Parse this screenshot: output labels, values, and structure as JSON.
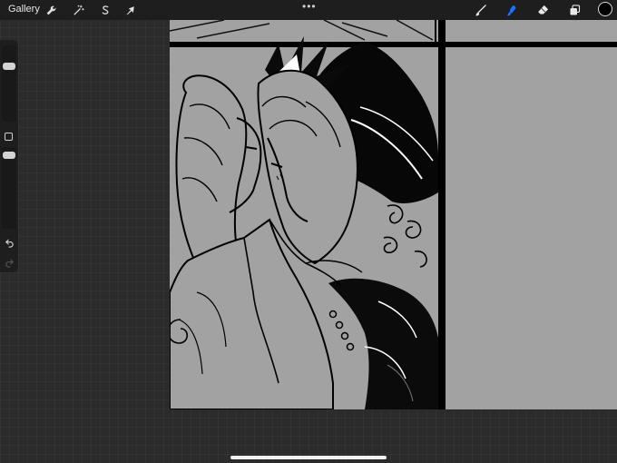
{
  "toolbar": {
    "gallery_label": "Gallery",
    "actions_icon": "wrench-icon",
    "adjustments_icon": "magic-wand-icon",
    "selection_icon": "selection-s-icon",
    "transform_icon": "arrow-cursor-icon",
    "more_icon": "more-dots-icon",
    "brush_icon": "brush-icon",
    "smudge_icon": "smudge-icon",
    "eraser_icon": "eraser-icon",
    "layers_icon": "layers-icon",
    "active_tool": "smudge",
    "accent_color": "#1a73ff",
    "current_color": "#000000"
  },
  "sidebar": {
    "brush_size_level": 0.38,
    "opacity_level": 0.28,
    "undo_icon": "undo-icon",
    "redo_icon": "redo-icon"
  },
  "canvas": {
    "background_color": "#a2a2a2",
    "content": "manga-panel-artwork"
  }
}
